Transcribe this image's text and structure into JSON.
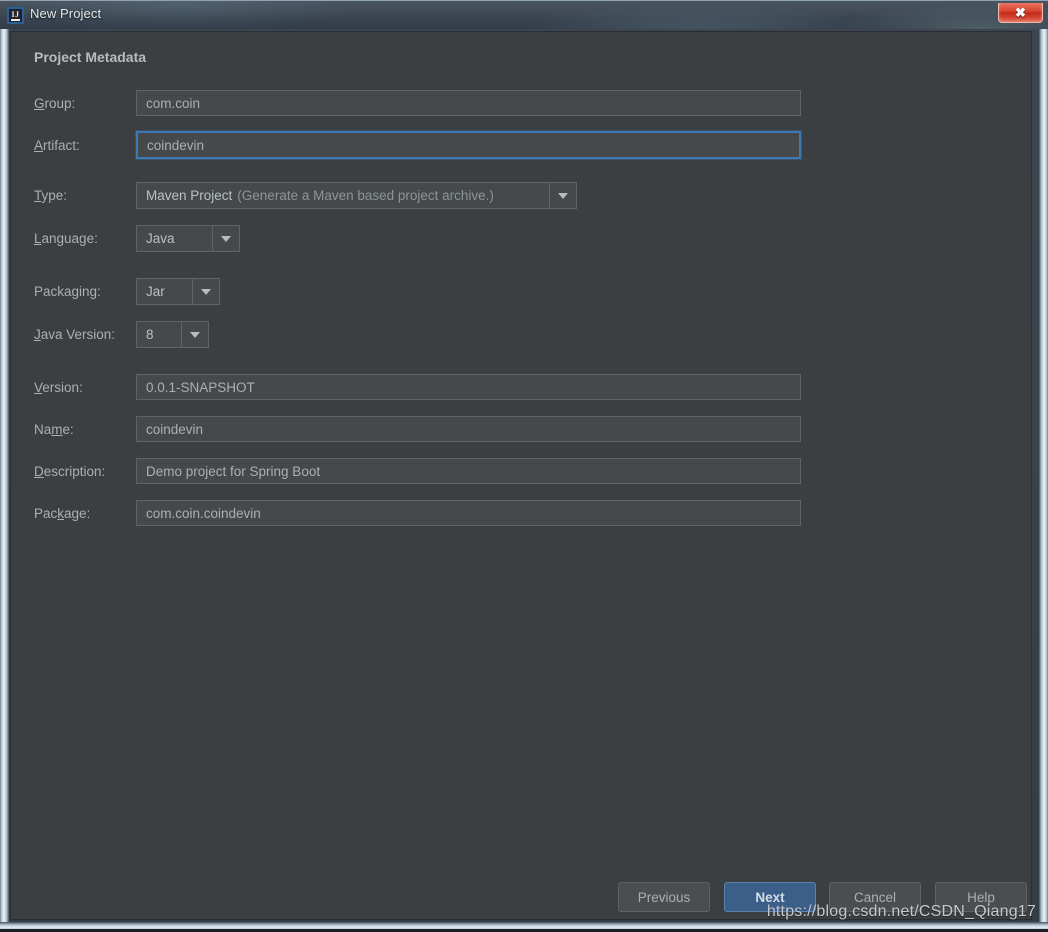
{
  "window": {
    "title": "New Project",
    "icon": "intellij-idea-icon",
    "close_label": "✖",
    "accent_focus": "#3d7ab5",
    "panel_bg": "#3c3f41",
    "primary_button_bg": "#3c5f8a"
  },
  "section": {
    "title": "Project Metadata"
  },
  "fields": [
    {
      "label_pre": "",
      "label_mnemonic": "G",
      "label_post": "roup:",
      "value": "com.coin",
      "focused": false
    },
    {
      "label_pre": "",
      "label_mnemonic": "A",
      "label_post": "rtifact:",
      "value": "coindevin",
      "focused": true
    }
  ],
  "combos": [
    {
      "label_pre": "",
      "label_mnemonic": "T",
      "label_post": "ype:",
      "value": "Maven Project",
      "value_detail": "(Generate a Maven based project archive.)",
      "arrow": "chevron-down-icon"
    },
    {
      "label_pre": "",
      "label_mnemonic": "L",
      "label_post": "anguage:",
      "value": "Java",
      "value_detail": "",
      "arrow": "chevron-down-icon"
    },
    {
      "label_pre": "Packa",
      "label_mnemonic": "g",
      "label_post": "ing:",
      "value": "Jar",
      "value_detail": "",
      "arrow": "chevron-down-icon"
    },
    {
      "label_pre": "",
      "label_mnemonic": "J",
      "label_post": "ava Version:",
      "value": "8",
      "value_detail": "",
      "arrow": "chevron-down-icon"
    }
  ],
  "fields2": [
    {
      "label_pre": "",
      "label_mnemonic": "V",
      "label_post": "ersion:",
      "value": "0.0.1-SNAPSHOT",
      "focused": false
    },
    {
      "label_pre": "Na",
      "label_mnemonic": "m",
      "label_post": "e:",
      "value": "coindevin",
      "focused": false
    },
    {
      "label_pre": "",
      "label_mnemonic": "D",
      "label_post": "escription:",
      "value": "Demo project for Spring Boot",
      "focused": false
    },
    {
      "label_pre": "Pac",
      "label_mnemonic": "k",
      "label_post": "age:",
      "value": "com.coin.coindevin",
      "focused": false
    }
  ],
  "buttons": {
    "previous": "Previous",
    "next": "Next",
    "cancel": "Cancel",
    "help": "Help"
  },
  "watermark": "https://blog.csdn.net/CSDN_Qiang17"
}
